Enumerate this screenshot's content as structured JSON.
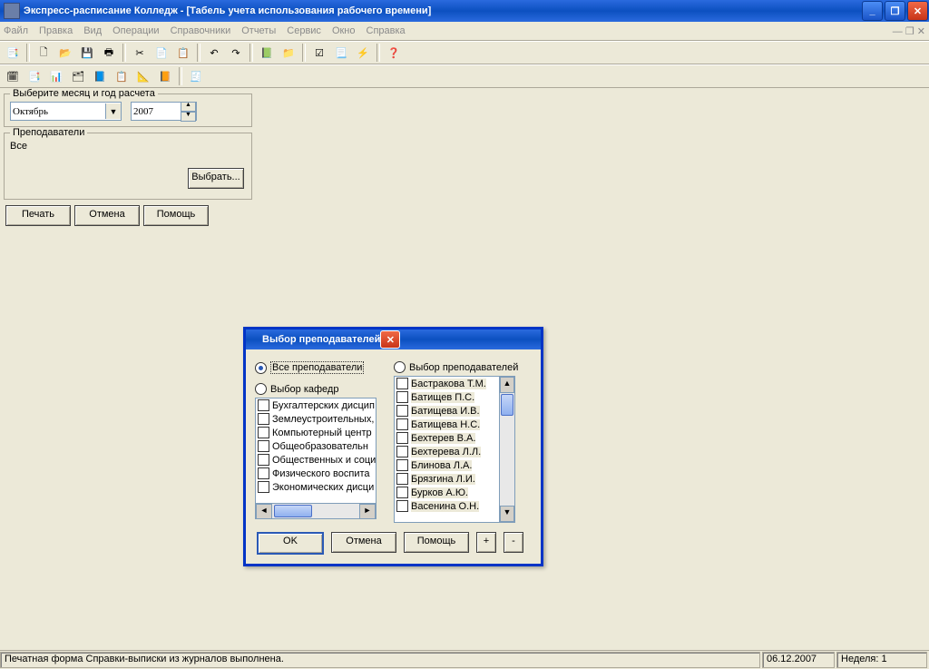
{
  "window": {
    "title": "Экспресс-расписание Колледж - [Табель учета использования рабочего времени]"
  },
  "menu": {
    "items": [
      "Файл",
      "Правка",
      "Вид",
      "Операции",
      "Справочники",
      "Отчеты",
      "Сервис",
      "Окно",
      "Справка"
    ]
  },
  "monthpanel": {
    "title": "Выберите месяц и год расчета",
    "month": "Октябрь",
    "year": "2007"
  },
  "teachers": {
    "title": "Преподаватели",
    "value": "Все",
    "select_btn": "Выбрать..."
  },
  "buttons": {
    "print": "Печать",
    "cancel": "Отмена",
    "help": "Помощь"
  },
  "dialog": {
    "title": "Выбор преподавателей",
    "radio_all": "Все преподаватели",
    "radio_dept": "Выбор кафедр",
    "radio_teach": "Выбор преподавателей",
    "departments": [
      "Бухгалтерских дисцип",
      "Землеустроительных,",
      "Компьютерный центр",
      "Общеобразовательн",
      "Общественных и соци",
      "Физического воспита",
      "Экономических дисци"
    ],
    "teacher_list": [
      "Бастракова Т.М.",
      "Батищев П.С.",
      "Батищева И.В.",
      "Батищева Н.С.",
      "Бехтерев В.А.",
      "Бехтерева Л.Л.",
      "Блинова Л.А.",
      "Брязгина Л.И.",
      "Бурков А.Ю.",
      "Васенина О.Н."
    ],
    "ok": "OK",
    "cancel": "Отмена",
    "help": "Помощь",
    "plus": "+",
    "minus": "-"
  },
  "status": {
    "msg": "Печатная форма Справки-выписки из журналов выполнена.",
    "date": "06.12.2007",
    "week": "Неделя: 1"
  }
}
